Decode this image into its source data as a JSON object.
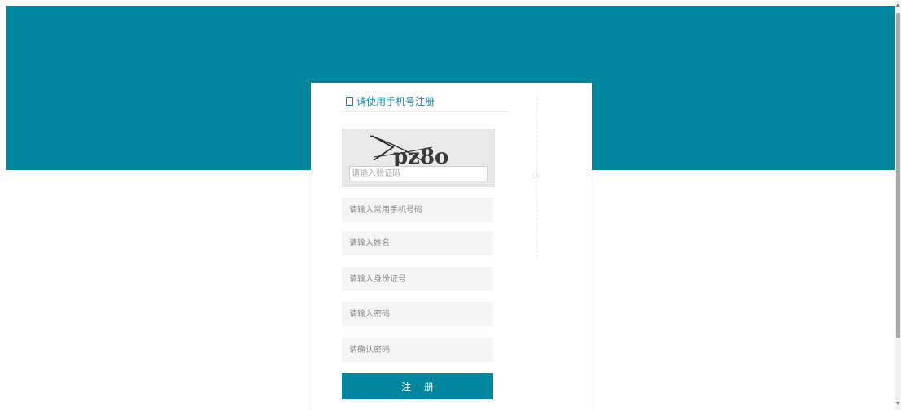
{
  "theme": {
    "header_color": "#00869f",
    "accent_color": "#008aa3",
    "button_color": "#00869f",
    "title_color": "#1f8ba3"
  },
  "form": {
    "title": "请使用手机号注册",
    "title_icon": "mobile-phone-icon",
    "captcha": {
      "image_text": "pz8o",
      "placeholder": "请输入验证码"
    },
    "fields": {
      "phone": {
        "placeholder": "请输入常用手机号码"
      },
      "name": {
        "placeholder": "请输入姓名"
      },
      "id_number": {
        "placeholder": "请输入身份证号"
      },
      "password": {
        "placeholder": "请输入密码"
      },
      "confirm_password": {
        "placeholder": "请确认密码"
      }
    },
    "submit_label": "注 册"
  },
  "side_mark": "CN"
}
